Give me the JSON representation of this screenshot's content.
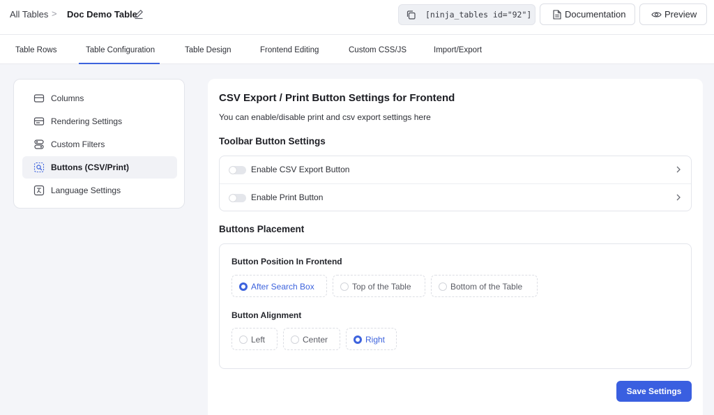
{
  "header": {
    "breadcrumb_root": "All Tables",
    "breadcrumb_separator": ">",
    "table_title": "Doc Demo Table",
    "shortcode": "[ninja_tables id=\"92\"]",
    "documentation_label": "Documentation",
    "preview_label": "Preview"
  },
  "tabs": [
    {
      "label": "Table Rows"
    },
    {
      "label": "Table Configuration",
      "active": true
    },
    {
      "label": "Table Design"
    },
    {
      "label": "Frontend Editing"
    },
    {
      "label": "Custom CSS/JS"
    },
    {
      "label": "Import/Export"
    }
  ],
  "sidebar": {
    "items": [
      {
        "label": "Columns",
        "icon": "columns-icon"
      },
      {
        "label": "Rendering Settings",
        "icon": "rendering-icon"
      },
      {
        "label": "Custom Filters",
        "icon": "filter-icon"
      },
      {
        "label": "Buttons (CSV/Print)",
        "icon": "buttons-icon",
        "active": true
      },
      {
        "label": "Language Settings",
        "icon": "language-icon"
      }
    ]
  },
  "main": {
    "title": "CSV Export / Print Button Settings for Frontend",
    "description": "You can enable/disable print and csv export settings here",
    "toolbar_heading": "Toolbar Button Settings",
    "toggles": [
      {
        "label": "Enable CSV Export Button",
        "enabled": false
      },
      {
        "label": "Enable Print Button",
        "enabled": false
      }
    ],
    "placement_heading": "Buttons Placement",
    "position_label": "Button Position In Frontend",
    "position_options": [
      {
        "label": "After Search Box",
        "checked": true
      },
      {
        "label": "Top of the Table",
        "checked": false
      },
      {
        "label": "Bottom of the Table",
        "checked": false
      }
    ],
    "alignment_label": "Button Alignment",
    "alignment_options": [
      {
        "label": "Left",
        "checked": false
      },
      {
        "label": "Center",
        "checked": false
      },
      {
        "label": "Right",
        "checked": true
      }
    ],
    "save_label": "Save Settings"
  },
  "colors": {
    "accent": "#3d63dd",
    "save_button": "#3a5fe0",
    "page_background": "#f4f5f9"
  }
}
